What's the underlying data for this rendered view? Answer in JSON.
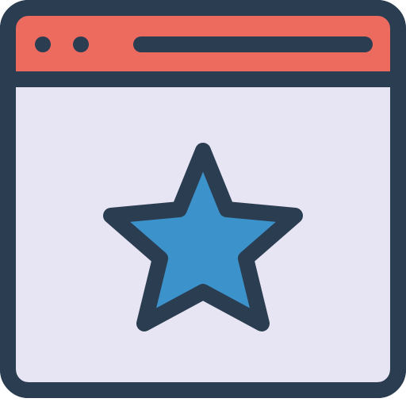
{
  "icon": {
    "name": "browser-window-star-icon",
    "colors": {
      "outline": "#2B3E51",
      "header": "#ED6A5E",
      "window_body": "#E7E5F3",
      "star_fill": "#3C92CB"
    },
    "header_dots": 2
  }
}
